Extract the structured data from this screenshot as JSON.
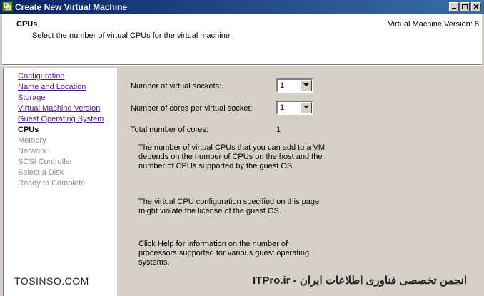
{
  "window": {
    "title": "Create New Virtual Machine",
    "accent": "#0a246a"
  },
  "header": {
    "title": "CPUs",
    "subtitle": "Select the number of virtual CPUs for the virtual machine.",
    "version": "Virtual Machine Version: 8"
  },
  "sidebar": {
    "items": [
      {
        "label": "Configuration",
        "state": "link"
      },
      {
        "label": "Name and Location",
        "state": "link"
      },
      {
        "label": "Storage",
        "state": "link"
      },
      {
        "label": "Virtual Machine Version",
        "state": "link"
      },
      {
        "label": "Guest Operating System",
        "state": "link"
      },
      {
        "label": "CPUs",
        "state": "current"
      },
      {
        "label": "Memory",
        "state": "disabled"
      },
      {
        "label": "Network",
        "state": "disabled"
      },
      {
        "label": "SCSI Controller",
        "state": "disabled"
      },
      {
        "label": "Select a Disk",
        "state": "disabled"
      },
      {
        "label": "Ready to Complete",
        "state": "disabled"
      }
    ]
  },
  "main": {
    "sockets_label": "Number of virtual sockets:",
    "sockets_value": "1",
    "cores_label": "Number of cores per virtual socket:",
    "cores_value": "1",
    "total_label": "Total number of cores:",
    "total_value": "1",
    "info1": "The number of virtual CPUs that you can add to a VM\ndepends on the number of CPUs on the host and the\nnumber of CPUs supported by the guest OS.",
    "info2": "The virtual CPU configuration specified on this page\nmight violate the license of the guest OS.",
    "info3": "Click Help for information on the number of\nprocessors supported for various guest operating\nsystems."
  },
  "watermark": {
    "left": "TOSINSO.COM",
    "right": "ITPro.ir - انجمن تخصصی فناوری اطلاعات ایران"
  }
}
